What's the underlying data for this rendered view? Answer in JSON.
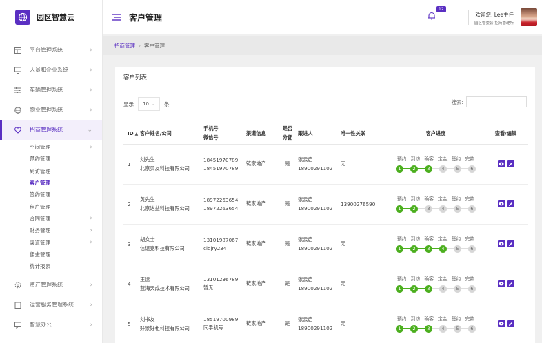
{
  "app": {
    "name": "园区智慧云"
  },
  "header": {
    "title": "客户管理",
    "notification_count": "12",
    "user_greeting": "欢迎您, Lee主任",
    "user_dept": "园区管委会-招商管理所"
  },
  "sidebar": {
    "items": [
      {
        "label": "平台管理系统",
        "icon": "grid-icon"
      },
      {
        "label": "人员和企业系统",
        "icon": "monitor-icon"
      },
      {
        "label": "车辆管理系统",
        "icon": "sliders-icon"
      },
      {
        "label": "物业管理系统",
        "icon": "globe-icon"
      },
      {
        "label": "招商管理系统",
        "icon": "heart-icon"
      },
      {
        "label": "资产管理系统",
        "icon": "gear-icon"
      },
      {
        "label": "运营服务管理系统",
        "icon": "building-icon"
      },
      {
        "label": "智慧办公",
        "icon": "chat-icon"
      }
    ],
    "sub_items": [
      {
        "label": "空间管理",
        "chevron": "›"
      },
      {
        "label": "预约管理",
        "chevron": ""
      },
      {
        "label": "到访管理",
        "chevron": ""
      },
      {
        "label": "客户管理",
        "chevron": ""
      },
      {
        "label": "签约管理",
        "chevron": ""
      },
      {
        "label": "租户管理",
        "chevron": ""
      },
      {
        "label": "合同管理",
        "chevron": "›"
      },
      {
        "label": "财务管理",
        "chevron": "›"
      },
      {
        "label": "渠道管理",
        "chevron": "›"
      },
      {
        "label": "佣金管理",
        "chevron": ""
      },
      {
        "label": "统计报表",
        "chevron": ""
      }
    ]
  },
  "breadcrumb": {
    "parent": "招商管理",
    "current": "客户管理"
  },
  "card": {
    "title": "客户列表",
    "show_label": "显示",
    "page_length": "10",
    "unit_label": "条",
    "search_label": "搜索:"
  },
  "table": {
    "headers": {
      "id": "ID",
      "name": "客户姓名/公司",
      "phone1": "手机号",
      "phone2": "微信号",
      "channel": "渠道信息",
      "split1": "是否",
      "split2": "分佣",
      "follower": "跟进人",
      "relation": "唯一性关联",
      "progress": "客户进度",
      "action": "查看/编辑"
    },
    "stage_labels": [
      "预约",
      "到访",
      "确客",
      "定金",
      "签约",
      "完款"
    ],
    "rows": [
      {
        "id": "1",
        "name": "刘先生",
        "company": "北京贝友科技有限公司",
        "phone": "18451970789",
        "wechat": "18451970789",
        "channel": "链家地产",
        "split": "是",
        "follower": "张云启",
        "follower_phone": "18900291102",
        "relation": "无",
        "done": 3
      },
      {
        "id": "2",
        "name": "黄先生",
        "company": "北京达益科技有限公司",
        "phone": "18972263654",
        "wechat": "18972263654",
        "channel": "链家地产",
        "split": "是",
        "follower": "张云启",
        "follower_phone": "18900291102",
        "relation": "13900276590",
        "done": 2
      },
      {
        "id": "3",
        "name": "胡女士",
        "company": "信谊克科技有限公司",
        "phone": "13101987067",
        "wechat": "cidjry234",
        "channel": "链家地产",
        "split": "是",
        "follower": "张云启",
        "follower_phone": "18900291102",
        "relation": "无",
        "done": 4
      },
      {
        "id": "4",
        "name": "王运",
        "company": "蓝海天成技术有限公司",
        "phone": "13101236789",
        "wechat": "暂无",
        "channel": "链家地产",
        "split": "是",
        "follower": "张云启",
        "follower_phone": "18900291102",
        "relation": "无",
        "done": 3
      },
      {
        "id": "5",
        "name": "刘书友",
        "company": "好景好租科技有限公司",
        "phone": "18519700989",
        "wechat": "同手机号",
        "channel": "链家地产",
        "split": "是",
        "follower": "张云启",
        "follower_phone": "18900291102",
        "relation": "无",
        "done": 3
      }
    ]
  },
  "colors": {
    "accent": "#5a2fc2",
    "progress_done": "#4caf1f",
    "progress_todo": "#d7d7d7"
  }
}
